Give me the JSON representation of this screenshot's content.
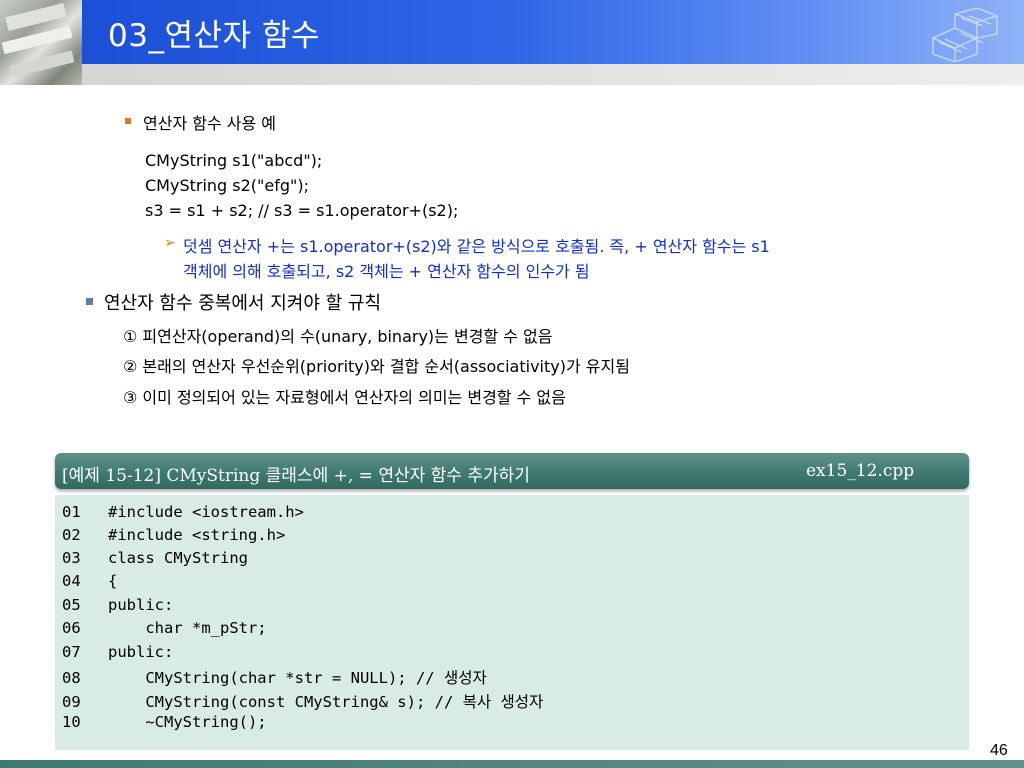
{
  "header": {
    "title": "03_연산자 함수"
  },
  "bullet1": {
    "label": "연산자 함수 사용 예",
    "code_lines": [
      "CMyString s1(\"abcd\");",
      "CMyString s2(\"efg\");",
      "s3 = s1 + s2; // s3 = s1.operator+(s2);"
    ],
    "note_line1": "덧셈 연산자 +는 s1.operator+(s2)와 같은 방식으로 호출됨. 즉, + 연산자 함수는 s1",
    "note_line2": "객체에 의해 호출되고, s2 객체는 + 연산자 함수의 인수가 됨"
  },
  "bullet2": {
    "label": "연산자 함수 중복에서 지켜야 할 규칙",
    "rules": [
      "① 피연산자(operand)의 수(unary, binary)는 변경할 수 없음",
      "② 본래의 연산자 우선순위(priority)와 결합 순서(associativity)가 유지됨",
      "③ 이미 정의되어 있는 자료형에서 연산자의 의미는 변경할 수 없음"
    ]
  },
  "example": {
    "title": "[예제 15-12] CMyString 클래스에 +, = 연산자 함수 추가하기",
    "filename": "ex15_12.cpp",
    "lines": [
      {
        "no": "01",
        "code": "#include <iostream.h>"
      },
      {
        "no": "02",
        "code": "#include <string.h>"
      },
      {
        "no": "03",
        "code": "class CMyString"
      },
      {
        "no": "04",
        "code": "{"
      },
      {
        "no": "05",
        "code": "public:"
      },
      {
        "no": "06",
        "code": "    char *m_pStr;"
      },
      {
        "no": "07",
        "code": "public:"
      },
      {
        "no": "08",
        "code": "    CMyString(char *str = NULL); // 생성자"
      },
      {
        "no": "09",
        "code": "    CMyString(const CMyString& s); // 복사 생성자"
      },
      {
        "no": "10",
        "code": "    ~CMyString();"
      }
    ]
  },
  "page_number": "46",
  "colors": {
    "header_blue": "#1b4fd6",
    "accent_orange": "#e07b1e",
    "note_blue": "#1030c8",
    "example_green": "#3f7a70",
    "code_bg": "#d9ebe6"
  }
}
